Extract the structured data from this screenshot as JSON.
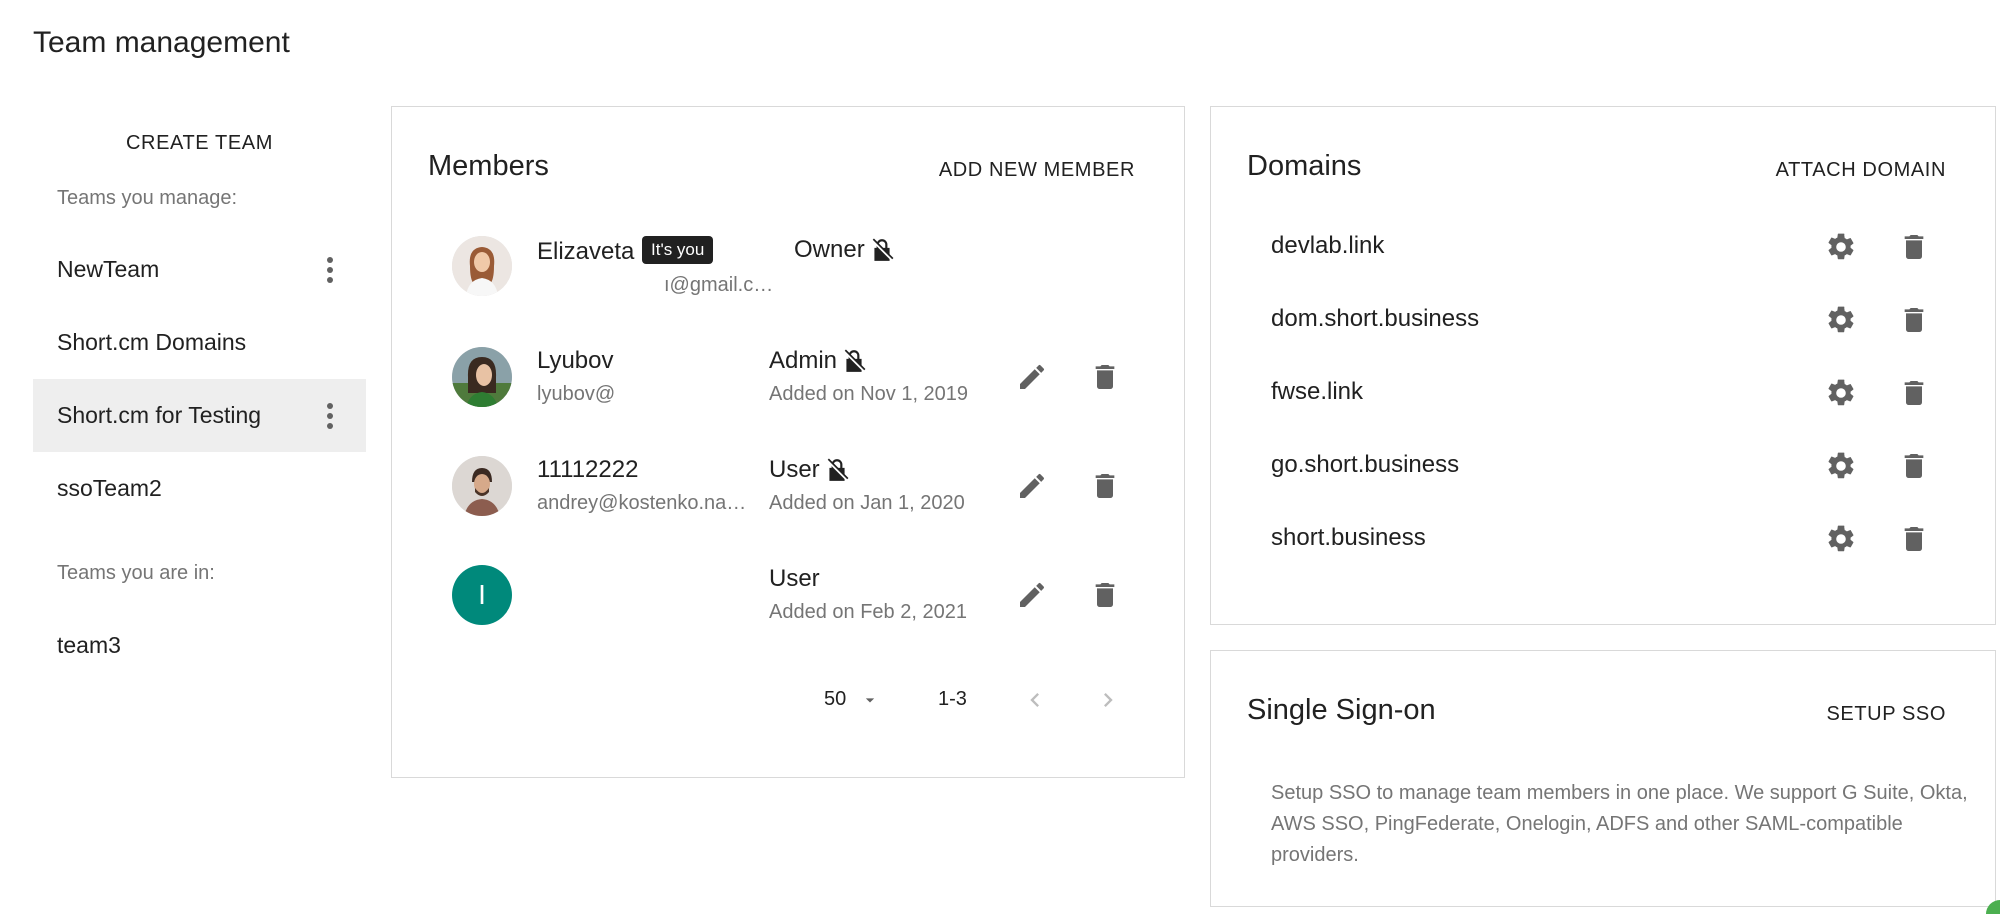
{
  "page": {
    "title": "Team management"
  },
  "sidebar": {
    "create_team_label": "CREATE TEAM",
    "manage_label": "Teams you manage:",
    "in_label": "Teams you are in:",
    "managed_teams": [
      {
        "label": "NewTeam",
        "has_menu": true,
        "active": false
      },
      {
        "label": "Short.cm Domains",
        "has_menu": false,
        "active": false
      },
      {
        "label": "Short.cm for Testing",
        "has_menu": true,
        "active": true
      },
      {
        "label": "ssoTeam2",
        "has_menu": false,
        "active": false
      }
    ],
    "member_teams": [
      {
        "label": "team3"
      }
    ]
  },
  "members": {
    "title": "Members",
    "add_label": "ADD NEW MEMBER",
    "rows": [
      {
        "name": "Elizaveta",
        "tag": "It's you",
        "email": "ı@gmail.c…",
        "role": "Owner",
        "locked": true,
        "added": "",
        "avatar": "photo-woman-1"
      },
      {
        "name": "Lyubov",
        "email": "lyubov@",
        "role": "Admin",
        "locked": true,
        "added": "Added on Nov 1, 2019",
        "avatar": "photo-woman-2"
      },
      {
        "name": "11112222",
        "email": "andrey@kostenko.na…",
        "role": "User",
        "locked": true,
        "added": "Added on Jan 1, 2020",
        "avatar": "photo-man-1"
      },
      {
        "name": "",
        "email": "",
        "role": "User",
        "locked": false,
        "added": "Added on Feb 2, 2021",
        "avatar_letter": "I"
      }
    ],
    "pager": {
      "page_size": "50",
      "range": "1-3"
    }
  },
  "domains": {
    "title": "Domains",
    "attach_label": "ATTACH DOMAIN",
    "items": [
      "devlab.link",
      "dom.short.business",
      "fwse.link",
      "go.short.business",
      "short.business"
    ]
  },
  "sso": {
    "title": "Single Sign-on",
    "setup_label": "SETUP SSO",
    "description": "Setup SSO to manage team members in one place. We support G Suite, Okta, AWS SSO, PingFederate, Onelogin, ADFS and other SAML-compatible providers."
  },
  "colors": {
    "accent_avatar": "#00897b",
    "active_bg": "#eeeeee",
    "icon_grey": "#616161"
  }
}
